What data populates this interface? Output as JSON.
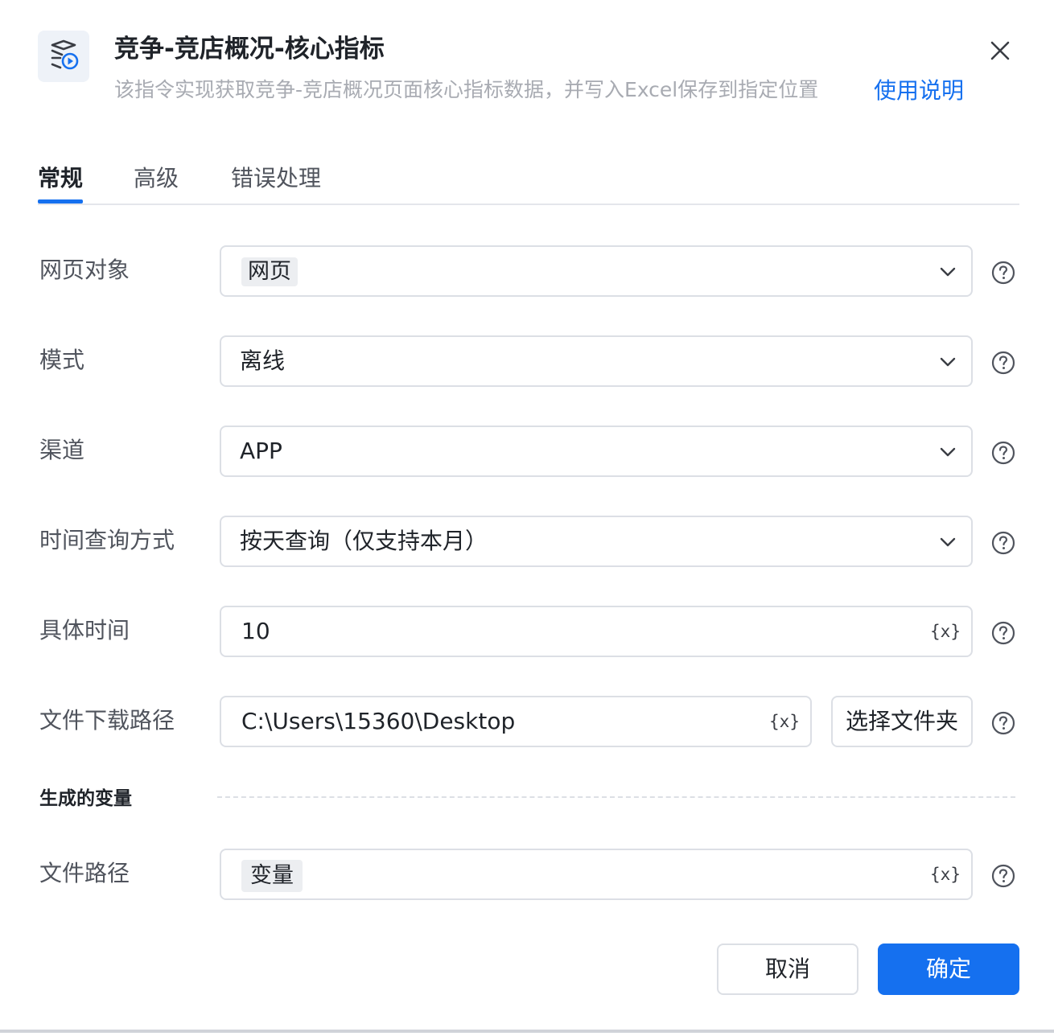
{
  "header": {
    "title": "竞争-竞店概况-核心指标",
    "subtitle": "该指令实现获取竞争-竞店概况页面核心指标数据，并写入Excel保存到指定位置",
    "help_link": "使用说明"
  },
  "tabs": [
    {
      "label": "常规",
      "active": true
    },
    {
      "label": "高级",
      "active": false
    },
    {
      "label": "错误处理",
      "active": false
    }
  ],
  "form": {
    "web_object": {
      "label": "网页对象",
      "value": "网页"
    },
    "mode": {
      "label": "模式",
      "value": "离线"
    },
    "channel": {
      "label": "渠道",
      "value": "APP"
    },
    "time_query": {
      "label": "时间查询方式",
      "value": "按天查询（仅支持本月）"
    },
    "specific_time": {
      "label": "具体时间",
      "value": "10"
    },
    "download_path": {
      "label": "文件下载路径",
      "value": "C:\\Users\\15360\\Desktop",
      "button": "选择文件夹"
    }
  },
  "generated_vars": {
    "section_title": "生成的变量",
    "file_path": {
      "label": "文件路径",
      "value": "变量"
    }
  },
  "variable_icon": "{x}",
  "footer": {
    "cancel": "取消",
    "ok": "确定"
  },
  "colors": {
    "accent": "#1570ef",
    "label": "#50545d",
    "subtitle": "#a8abb2"
  }
}
